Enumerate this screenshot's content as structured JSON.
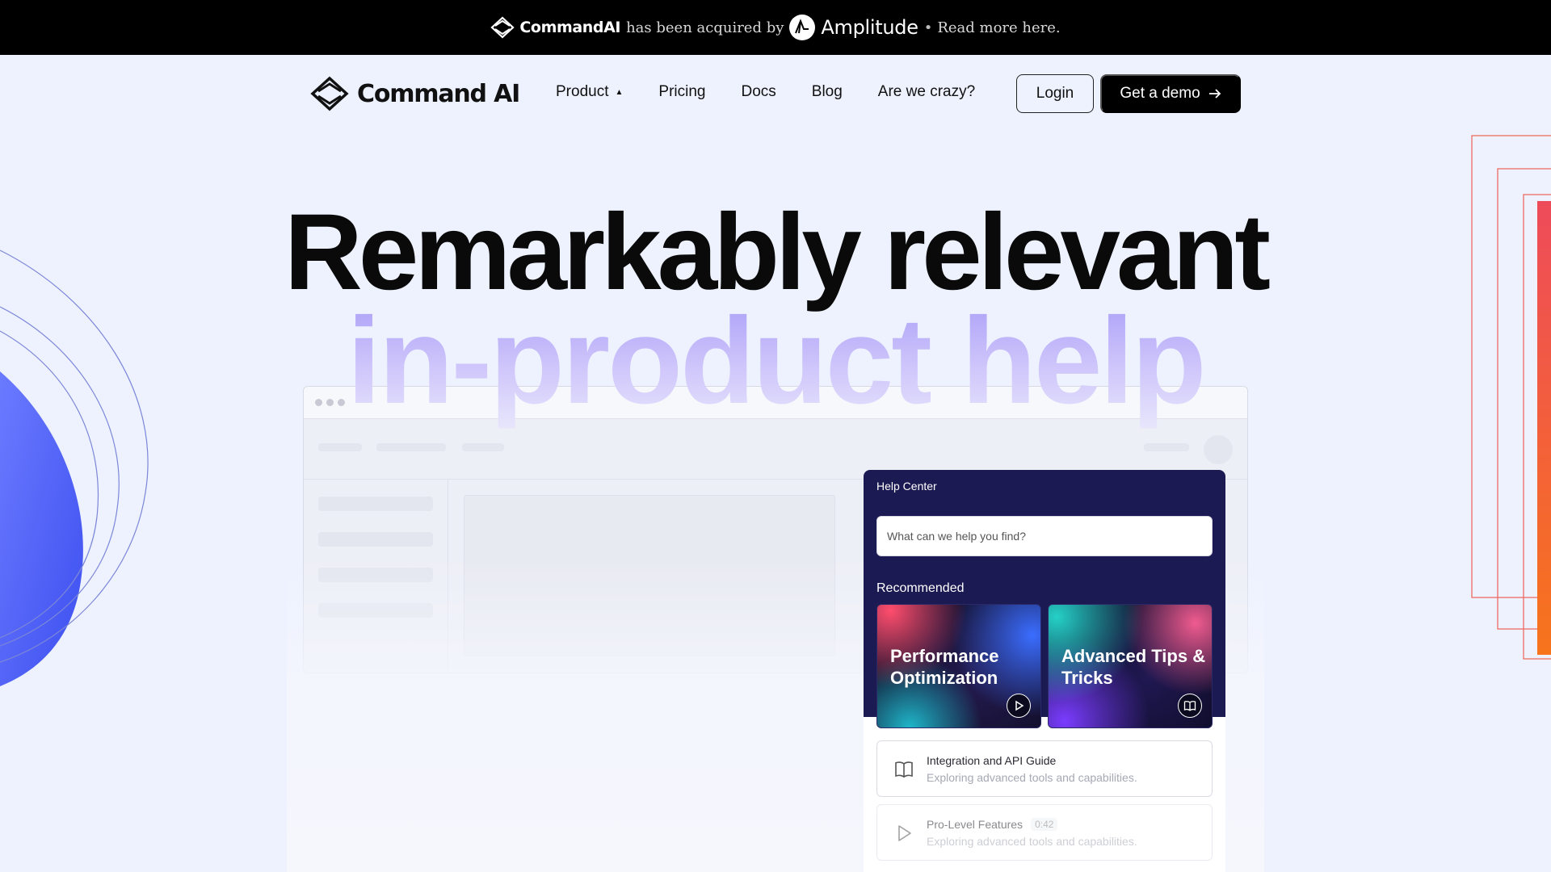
{
  "announcement": {
    "brand": "CommandAI",
    "middle": "has been acquired by",
    "acquirer": "Amplitude",
    "separator": "•",
    "cta": "Read more here."
  },
  "nav": {
    "logo": "Command AI",
    "links": [
      "Product",
      "Pricing",
      "Docs",
      "Blog",
      "Are we crazy?"
    ],
    "login": "Login",
    "demo": "Get a demo"
  },
  "hero": {
    "line1": "Remarkably relevant",
    "line2": "in-product help"
  },
  "help_center": {
    "title": "Help Center",
    "search_placeholder": "What can we help you find?",
    "recommended_label": "Recommended",
    "cards": [
      {
        "title": "Performance Optimization",
        "icon": "play-icon"
      },
      {
        "title": "Advanced Tips & Tricks",
        "icon": "book-icon"
      }
    ],
    "items": [
      {
        "title": "Integration and API Guide",
        "subtitle": "Exploring advanced tools and capabilities.",
        "icon": "book-icon",
        "badge": ""
      },
      {
        "title": "Pro-Level Features",
        "subtitle": "Exploring advanced tools and capabilities.",
        "icon": "play-icon",
        "badge": "0:42"
      }
    ]
  },
  "colors": {
    "page_bg": "#edf2fe",
    "panel_bg": "#1c1a52",
    "accent_purple": "#a89cf7",
    "accent_orange": "#f4641e"
  }
}
